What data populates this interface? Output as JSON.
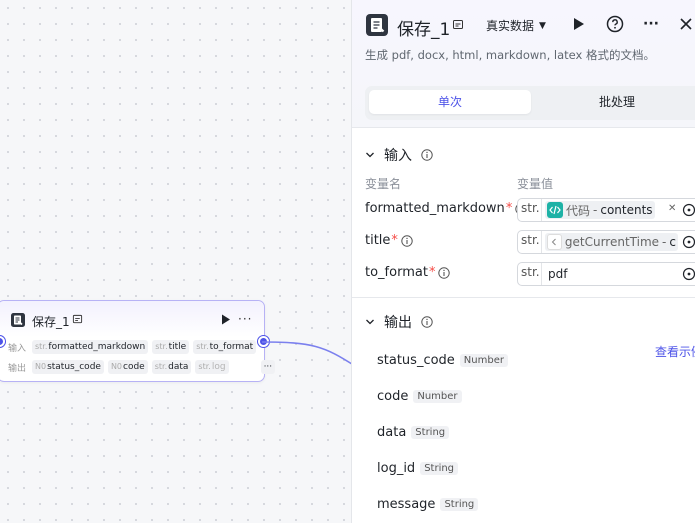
{
  "node": {
    "title": "保存_1",
    "input_label": "输入",
    "output_label": "输出",
    "inputs": [
      {
        "type": "str.",
        "name": "formatted_markdown"
      },
      {
        "type": "str.",
        "name": "title"
      },
      {
        "type": "str.",
        "name": "to_format"
      }
    ],
    "outputs": [
      {
        "type": "N0",
        "name": "status_code"
      },
      {
        "type": "N0",
        "name": "code"
      },
      {
        "type": "str.",
        "name": "data"
      },
      {
        "type": "str.",
        "name": "log"
      }
    ],
    "more_outputs": "···"
  },
  "panel": {
    "title": "保存_1",
    "mode": "真实数据",
    "description": "生成 pdf, docx, html, markdown, latex 格式的文档。",
    "tabs": {
      "single": "单次",
      "batch": "批处理"
    },
    "input_section": {
      "title": "输入",
      "col_name": "变量名",
      "col_value": "变量值",
      "variables": [
        {
          "name": "formatted_markdown",
          "type": "str.",
          "ref_source": "代码",
          "ref_sep": " - ",
          "ref_field": "contents"
        },
        {
          "name": "title",
          "type": "str.",
          "ref_source": "getCurrentTime",
          "ref_sep": " - ",
          "ref_field": "c"
        },
        {
          "name": "to_format",
          "type": "str.",
          "value": "pdf"
        }
      ]
    },
    "output_section": {
      "title": "输出",
      "view_example": "查看示例",
      "fields": [
        {
          "name": "status_code",
          "type": "Number"
        },
        {
          "name": "code",
          "type": "Number"
        },
        {
          "name": "data",
          "type": "String"
        },
        {
          "name": "log_id",
          "type": "String"
        },
        {
          "name": "message",
          "type": "String"
        }
      ]
    }
  },
  "colors": {
    "accent": "#4d53e8",
    "required": "#f54a45",
    "code_icon": "#1eb2a6"
  }
}
